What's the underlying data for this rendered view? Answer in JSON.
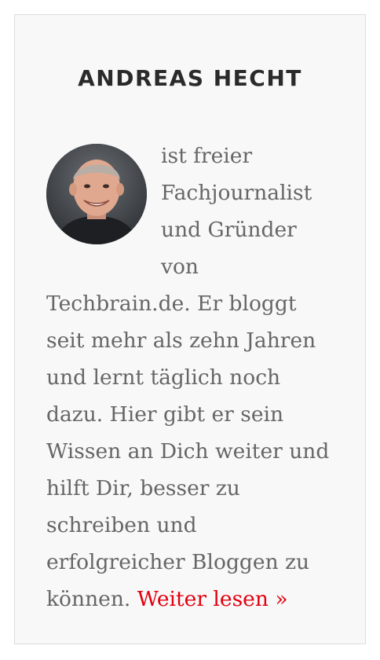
{
  "widget": {
    "title": "ANDREAS HECHT",
    "bio": "ist freier Fachjournalist und Gründer von Techbrain.de. Er bloggt seit mehr als zehn Jahren und lernt täglich noch dazu. Hier gibt er sein Wissen an Dich weiter und hilft Dir, besser zu schreiben und erfolgreicher Bloggen zu können.",
    "read_more_label": "Weiter lesen »"
  },
  "colors": {
    "title": "#2a2a2a",
    "body_text": "#666666",
    "link": "#e3000f",
    "panel_background": "#f8f8f8",
    "panel_border": "#dcdcdc"
  },
  "icons": {
    "avatar": "author-portrait-photo"
  }
}
